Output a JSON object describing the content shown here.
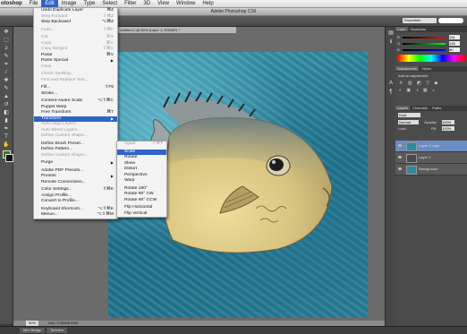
{
  "menubar": {
    "app": "otoshop",
    "items": [
      "File",
      "Edit",
      "Image",
      "Type",
      "Select",
      "Filter",
      "3D",
      "View",
      "Window",
      "Help"
    ]
  },
  "window": {
    "title": "Adobe Photoshop CS6"
  },
  "options": {
    "workspace": "Essentials"
  },
  "document": {
    "tab": "Untitled-1 @ 50% (Layer 1, RGB/8*) *",
    "zoom": "50%",
    "doc_info": "Doc: 3.00M/6.00M"
  },
  "bottom_tabs": [
    "Mini Bridge",
    "Timeline"
  ],
  "colors": {
    "fg": "#3a7a16",
    "bg": "#111111",
    "highlight": "#2f63c9"
  },
  "panels": {
    "color_tabs": [
      "Color",
      "Swatches"
    ],
    "rgb": [
      {
        "label": "R",
        "value": "116"
      },
      {
        "label": "G",
        "value": "136"
      },
      {
        "label": "B",
        "value": "80"
      }
    ],
    "adjust_tabs": [
      "Adjustments",
      "Styles"
    ],
    "adjust_label": "Add an adjustment",
    "layer_tabs": [
      "Layers",
      "Channels",
      "Paths"
    ],
    "kind": "Kind",
    "blend": "Normal",
    "opacity_label": "Opacity:",
    "opacity": "100%",
    "lock_label": "Lock:",
    "fill_label": "Fill:",
    "fill": "100%",
    "layers": [
      {
        "name": "Layer 1 copy",
        "selected": true
      },
      {
        "name": "Layer 1",
        "selected": false
      },
      {
        "name": "Background",
        "selected": false
      }
    ]
  },
  "edit_menu": [
    {
      "label": "Undo Duplicate Layer",
      "sc": "⌘Z"
    },
    {
      "label": "Step Forward",
      "sc": "⇧⌘Z",
      "dis": true
    },
    {
      "label": "Step Backward",
      "sc": "⌥⌘Z"
    },
    {
      "sep": true
    },
    {
      "label": "Fade...",
      "sc": "⇧⌘F",
      "dis": true
    },
    {
      "sep": true
    },
    {
      "label": "Cut",
      "sc": "⌘X",
      "dis": true
    },
    {
      "label": "Copy",
      "sc": "⌘C",
      "dis": true
    },
    {
      "label": "Copy Merged",
      "sc": "⇧⌘C",
      "dis": true
    },
    {
      "label": "Paste",
      "sc": "⌘V"
    },
    {
      "label": "Paste Special",
      "arrow": true
    },
    {
      "label": "Clear",
      "dis": true
    },
    {
      "sep": true
    },
    {
      "label": "Check Spelling...",
      "dis": true
    },
    {
      "label": "Find and Replace Text...",
      "dis": true
    },
    {
      "sep": true
    },
    {
      "label": "Fill...",
      "sc": "⇧F5"
    },
    {
      "label": "Stroke..."
    },
    {
      "sep": true
    },
    {
      "label": "Content-Aware Scale",
      "sc": "⌥⇧⌘C"
    },
    {
      "label": "Puppet Warp"
    },
    {
      "label": "Free Transform",
      "sc": "⌘T"
    },
    {
      "label": "Transform",
      "arrow": true,
      "hi": true
    },
    {
      "label": "Auto-Align Layers...",
      "dis": true
    },
    {
      "label": "Auto-Blend Layers...",
      "dis": true
    },
    {
      "label": "Define Custom Shape...",
      "dis": true
    },
    {
      "sep": true
    },
    {
      "label": "Define Brush Preset..."
    },
    {
      "label": "Define Pattern..."
    },
    {
      "label": "Define Custom Shape...",
      "dis": true
    },
    {
      "sep": true
    },
    {
      "label": "Purge",
      "arrow": true
    },
    {
      "sep": true
    },
    {
      "label": "Adobe PDF Presets..."
    },
    {
      "label": "Presets",
      "arrow": true
    },
    {
      "label": "Remote Connections..."
    },
    {
      "sep": true
    },
    {
      "label": "Color Settings...",
      "sc": "⇧⌘K"
    },
    {
      "label": "Assign Profile..."
    },
    {
      "label": "Convert to Profile..."
    },
    {
      "sep": true
    },
    {
      "label": "Keyboard Shortcuts...",
      "sc": "⌥⇧⌘K"
    },
    {
      "label": "Menus...",
      "sc": "⌥⇧⌘M"
    }
  ],
  "transform_menu": [
    {
      "label": "Again",
      "sc": "⇧⌘T",
      "dis": true
    },
    {
      "sep": true
    },
    {
      "label": "Scale",
      "hi": true
    },
    {
      "label": "Rotate"
    },
    {
      "label": "Skew"
    },
    {
      "label": "Distort"
    },
    {
      "label": "Perspective"
    },
    {
      "label": "Warp"
    },
    {
      "sep": true
    },
    {
      "label": "Rotate 180°"
    },
    {
      "label": "Rotate 90° CW"
    },
    {
      "label": "Rotate 90° CCW"
    },
    {
      "sep": true
    },
    {
      "label": "Flip Horizontal"
    },
    {
      "label": "Flip Vertical"
    }
  ]
}
